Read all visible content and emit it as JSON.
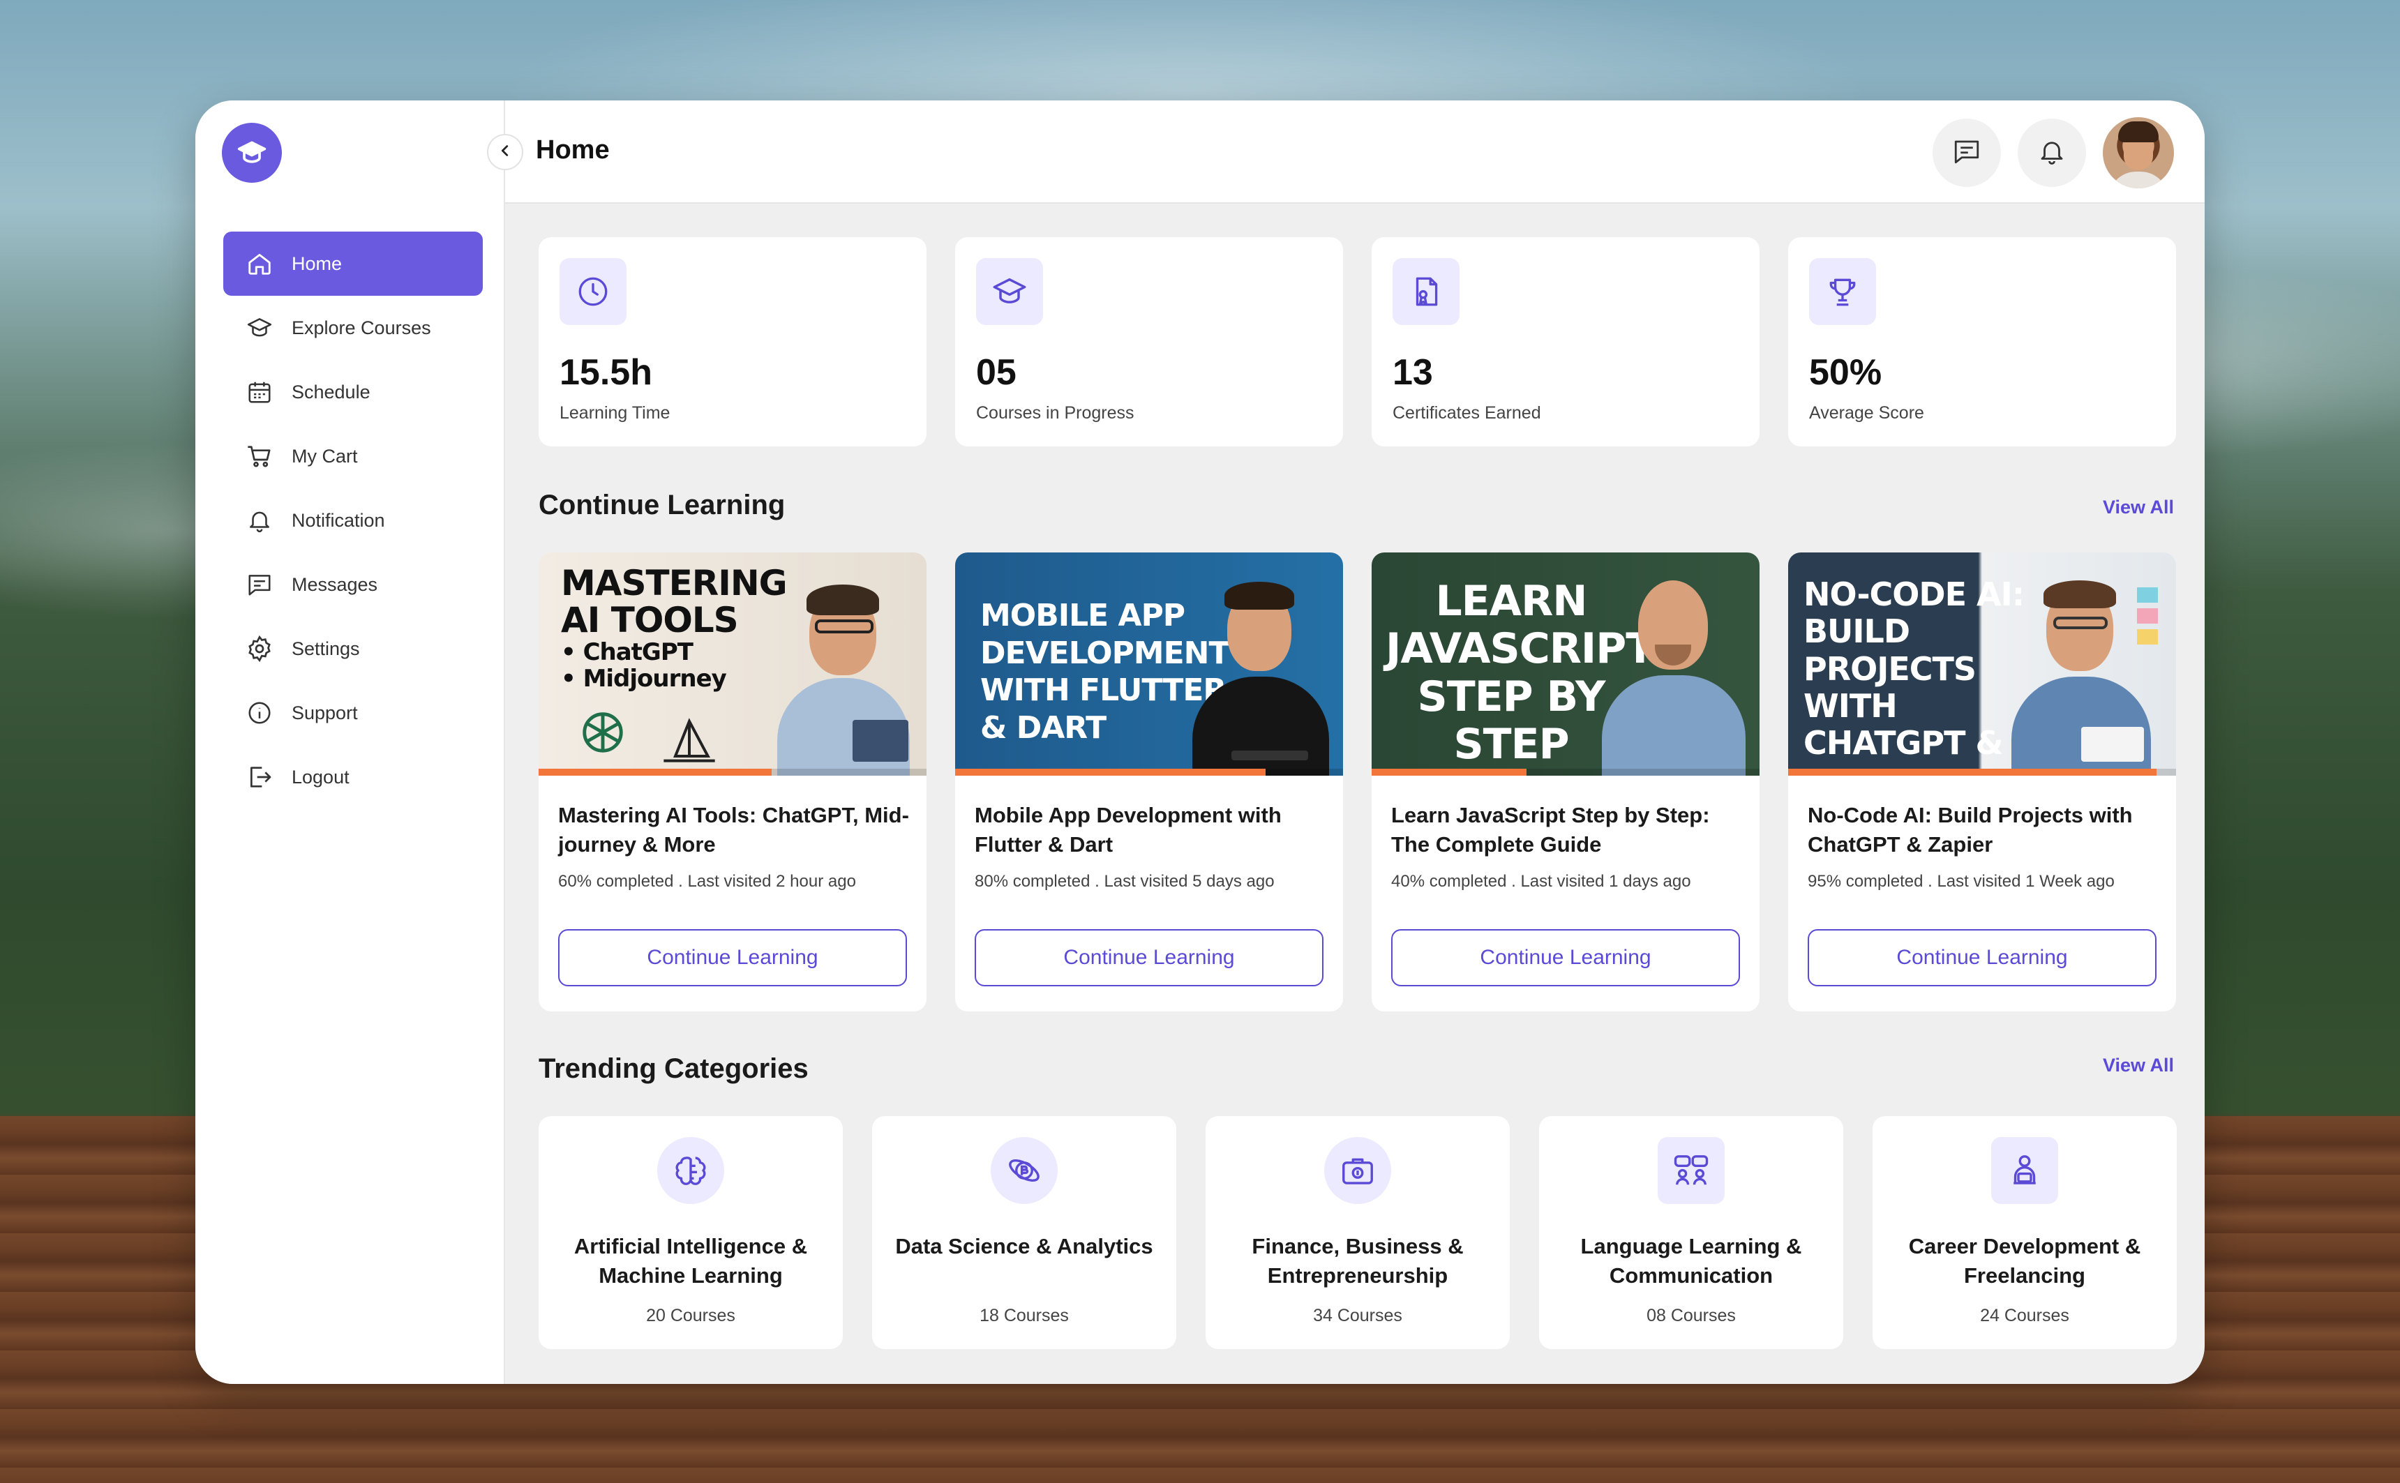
{
  "header": {
    "title": "Home"
  },
  "sidebar": {
    "items": [
      {
        "label": "Home",
        "icon": "home-icon",
        "active": true
      },
      {
        "label": "Explore Courses",
        "icon": "graduation-cap-icon"
      },
      {
        "label": "Schedule",
        "icon": "calendar-icon"
      },
      {
        "label": "My Cart",
        "icon": "cart-icon"
      },
      {
        "label": "Notification",
        "icon": "bell-icon"
      },
      {
        "label": "Messages",
        "icon": "message-icon"
      },
      {
        "label": "Settings",
        "icon": "gear-icon"
      },
      {
        "label": "Support",
        "icon": "info-icon"
      },
      {
        "label": "Logout",
        "icon": "logout-icon"
      }
    ]
  },
  "stats": [
    {
      "value": "15.5h",
      "label": "Learning Time",
      "icon": "clock-icon"
    },
    {
      "value": "05",
      "label": "Courses in Progress",
      "icon": "graduation-cap-icon"
    },
    {
      "value": "13",
      "label": "Certificates Earned",
      "icon": "certificate-icon"
    },
    {
      "value": "50%",
      "label": "Average Score",
      "icon": "trophy-icon"
    }
  ],
  "continue_learning": {
    "title": "Continue Learning",
    "view_all": "View All",
    "courses": [
      {
        "thumb_lines": [
          "MASTERING",
          "AI TOOLS",
          "• ChatGPT",
          "• Midjourney"
        ],
        "title": "Mastering AI Tools: ChatGPT, Mid-journey & More",
        "meta": "60% completed . Last visited 2 hour ago",
        "progress": 0.6,
        "button": "Continue Learning"
      },
      {
        "thumb_lines": [
          "MOBILE APP",
          "DEVELOPMENT",
          "WITH FLUTTER",
          "& DART"
        ],
        "title": "Mobile App Development with Flutter & Dart",
        "meta": "80% completed . Last visited 5 days ago",
        "progress": 0.8,
        "button": "Continue Learning"
      },
      {
        "thumb_lines": [
          "LEARN",
          "JAVASCRIPT",
          "STEP BY",
          "STEP"
        ],
        "title": "Learn JavaScript Step by Step: The Complete Guide",
        "meta": "40% completed . Last visited 1 days ago",
        "progress": 0.4,
        "button": "Continue Learning"
      },
      {
        "thumb_lines": [
          "NO-CODE AI:",
          "BUILD",
          "PROJECTS",
          "WITH",
          "CHATGPT &"
        ],
        "title": "No-Code AI: Build Projects with ChatGPT & Zapier",
        "meta": "95% completed . Last visited 1 Week ago",
        "progress": 0.95,
        "button": "Continue Learning"
      }
    ]
  },
  "trending": {
    "title": "Trending Categories",
    "view_all": "View All",
    "categories": [
      {
        "name": "Artificial Intelligence & Machine Learning",
        "count": "20 Courses",
        "icon": "brain-icon"
      },
      {
        "name": "Data Science & Analytics",
        "count": "18 Courses",
        "icon": "bitcoin-analytics-icon"
      },
      {
        "name": "Finance, Business & Entrepreneurship",
        "count": "34 Courses",
        "icon": "briefcase-money-icon"
      },
      {
        "name": "Language Learning & Communication",
        "count": "08 Courses",
        "icon": "conversation-icon"
      },
      {
        "name": "Career Development & Freelancing",
        "count": "24 Courses",
        "icon": "person-laptop-icon"
      }
    ]
  },
  "colors": {
    "accent": "#6a5ae0",
    "accent_text": "#5a4ad6",
    "progress": "#f2763a"
  }
}
